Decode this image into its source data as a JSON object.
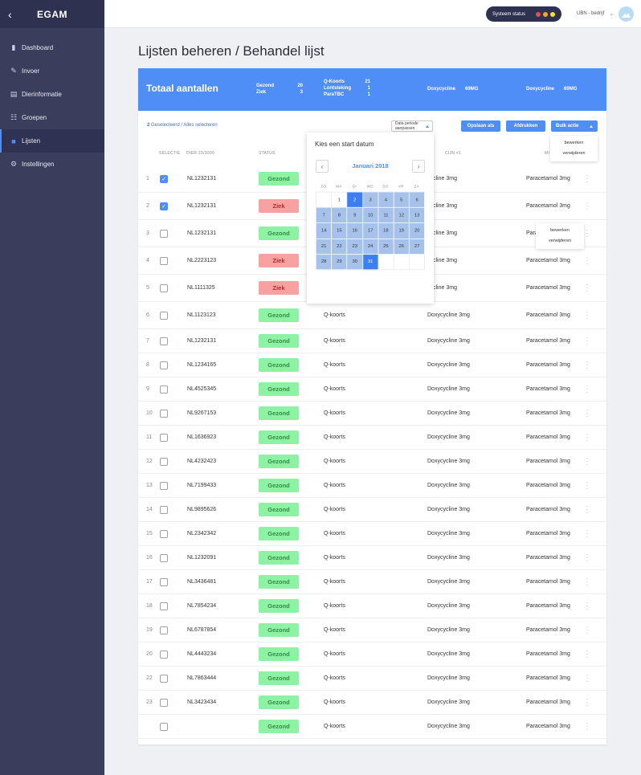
{
  "sidebar": {
    "app_title": "EGAM",
    "items": [
      {
        "label": "Dashboard",
        "icon": "chart-icon"
      },
      {
        "label": "Invoer",
        "icon": "edit-icon"
      },
      {
        "label": "Dierinformatie",
        "icon": "document-icon"
      },
      {
        "label": "Groepen",
        "icon": "group-icon"
      },
      {
        "label": "Lijsten",
        "icon": "list-icon",
        "active": true
      },
      {
        "label": "Instellingen",
        "icon": "gear-icon"
      }
    ]
  },
  "topbar": {
    "status_label": "Systeem status",
    "status_colors": [
      "#e94b4b",
      "#f5a623",
      "#f8e71c"
    ],
    "company": "UBN - bedrijf"
  },
  "page_title": "Lijsten beheren / Behandel lijst",
  "totals": {
    "title": "Totaal aantallen",
    "group1": [
      {
        "label": "Gezond",
        "value": "20"
      },
      {
        "label": "Ziek",
        "value": "3"
      }
    ],
    "group2": [
      {
        "label": "Q-Koorts",
        "value": "21"
      },
      {
        "label": "Lontsteking",
        "value": "1"
      },
      {
        "label": "ParaTBC",
        "value": "1"
      }
    ],
    "group3": {
      "label": "Doxycycline",
      "value": "69MG"
    },
    "group4": {
      "label": "Doxycycline",
      "value": "69MG"
    }
  },
  "toolbar": {
    "selection_count": "2",
    "selection_text": "Geselecteerd / Alles selecteren",
    "period_label": "Data periode aanpassen",
    "save_label": "Opslaan als",
    "print_label": "Afdrukken",
    "bulk_label": "Bulk actie",
    "bulk_menu": [
      "bewerken",
      "verwijderen"
    ],
    "row_menu": [
      "bewerken",
      "verwijderen"
    ]
  },
  "table": {
    "headers": {
      "selectie": "SELECTIE",
      "dier": "DIER 23/3000",
      "status": "STATUS",
      "med1": "CIJN #1",
      "med2": "MI"
    },
    "rows": [
      {
        "num": "1",
        "checked": true,
        "animal": "NL1232131",
        "status": "Gezond",
        "disease": "",
        "med1": "cycline 3mg",
        "med2": "Paracetamol 3mg"
      },
      {
        "num": "2",
        "checked": true,
        "animal": "NL1232131",
        "status": "Ziek",
        "disease": "",
        "med1": "cycline 3mg",
        "med2": "Paracetamol 3mg"
      },
      {
        "num": "3",
        "checked": false,
        "animal": "NL1232131",
        "status": "Gezond",
        "disease": "",
        "med1": "cycline 3mg",
        "med2": "Para"
      },
      {
        "num": "4",
        "checked": false,
        "animal": "NL2223123",
        "status": "Ziek",
        "disease": "",
        "med1": "cycline 3mg",
        "med2": "Paracetamol 3mg"
      },
      {
        "num": "5",
        "checked": false,
        "animal": "NL1111325",
        "status": "Ziek",
        "disease": "",
        "med1": "cycline 3mg",
        "med2": "Paracetamol 3mg"
      },
      {
        "num": "6",
        "checked": false,
        "animal": "NL1123123",
        "status": "Gezond",
        "disease": "Q-koorts",
        "med1": "Doxycycline 3mg",
        "med2": "Paracetamol 3mg"
      },
      {
        "num": "7",
        "checked": false,
        "animal": "NL1232131",
        "status": "Gezond",
        "disease": "Q-koorts",
        "med1": "Doxycycline 3mg",
        "med2": "Paracetamol 3mg"
      },
      {
        "num": "8",
        "checked": false,
        "animal": "NL1234165",
        "status": "Gezond",
        "disease": "Q-koorts",
        "med1": "Doxycycline 3mg",
        "med2": "Paracetamol 3mg"
      },
      {
        "num": "9",
        "checked": false,
        "animal": "NL4525345",
        "status": "Gezond",
        "disease": "Q-koorts",
        "med1": "Doxycycline 3mg",
        "med2": "Paracetamol 3mg"
      },
      {
        "num": "10",
        "checked": false,
        "animal": "NL9267153",
        "status": "Gezond",
        "disease": "Q-koorts",
        "med1": "Doxycycline 3mg",
        "med2": "Paracetamol 3mg"
      },
      {
        "num": "11",
        "checked": false,
        "animal": "NL1636923",
        "status": "Gezond",
        "disease": "Q-koorts",
        "med1": "Doxycycline 3mg",
        "med2": "Paracetamol 3mg"
      },
      {
        "num": "12",
        "checked": false,
        "animal": "NL4232423",
        "status": "Gezond",
        "disease": "Q-koorts",
        "med1": "Doxycycline 3mg",
        "med2": "Paracetamol 3mg"
      },
      {
        "num": "13",
        "checked": false,
        "animal": "NL7199433",
        "status": "Gezond",
        "disease": "Q-koorts",
        "med1": "Doxycycline 3mg",
        "med2": "Paracetamol 3mg"
      },
      {
        "num": "14",
        "checked": false,
        "animal": "NL9895626",
        "status": "Gezond",
        "disease": "Q-koorts",
        "med1": "Doxycycline 3mg",
        "med2": "Paracetamol 3mg"
      },
      {
        "num": "15",
        "checked": false,
        "animal": "NL2342342",
        "status": "Gezond",
        "disease": "Q-koorts",
        "med1": "Doxycycline 3mg",
        "med2": "Paracetamol 3mg"
      },
      {
        "num": "16",
        "checked": false,
        "animal": "NL1232091",
        "status": "Gezond",
        "disease": "Q-koorts",
        "med1": "Doxycycline 3mg",
        "med2": "Paracetamol 3mg"
      },
      {
        "num": "17",
        "checked": false,
        "animal": "NL3436481",
        "status": "Gezond",
        "disease": "Q-koorts",
        "med1": "Doxycycline 3mg",
        "med2": "Paracetamol 3mg"
      },
      {
        "num": "18",
        "checked": false,
        "animal": "NL7854234",
        "status": "Gezond",
        "disease": "Q-koorts",
        "med1": "Doxycycline 3mg",
        "med2": "Paracetamol 3mg"
      },
      {
        "num": "19",
        "checked": false,
        "animal": "NL6787854",
        "status": "Gezond",
        "disease": "Q-koorts",
        "med1": "Doxycycline 3mg",
        "med2": "Paracetamol 3mg"
      },
      {
        "num": "20",
        "checked": false,
        "animal": "NL4443234",
        "status": "Gezond",
        "disease": "Q-koorts",
        "med1": "Doxycycline 3mg",
        "med2": "Paracetamol 3mg"
      },
      {
        "num": "22",
        "checked": false,
        "animal": "NL7863444",
        "status": "Gezond",
        "disease": "Q-koorts",
        "med1": "Doxycycline 3mg",
        "med2": "Paracetamol 3mg"
      },
      {
        "num": "23",
        "checked": false,
        "animal": "NL3423434",
        "status": "Gezond",
        "disease": "Q-koorts",
        "med1": "Doxycycline 3mg",
        "med2": "Paracetamol 3mg"
      },
      {
        "num": "",
        "checked": false,
        "animal": "",
        "status": "Gezond",
        "disease": "Q-koorts",
        "med1": "Doxycycline 3mg",
        "med2": "Paracetamol 3mg"
      }
    ]
  },
  "datepicker": {
    "title": "Kies een start datum",
    "month": "Januari 2018",
    "weekdays": [
      "ZO",
      "MA",
      "DI",
      "WO",
      "DO",
      "VR",
      "ZA"
    ],
    "days": [
      "",
      "1",
      "2",
      "3",
      "4",
      "5",
      "6",
      "7",
      "8",
      "9",
      "10",
      "11",
      "12",
      "13",
      "14",
      "15",
      "16",
      "17",
      "18",
      "19",
      "20",
      "21",
      "22",
      "23",
      "24",
      "25",
      "26",
      "27",
      "28",
      "29",
      "30",
      "31",
      "",
      "",
      ""
    ],
    "range_start": "2",
    "range_end": "31"
  }
}
